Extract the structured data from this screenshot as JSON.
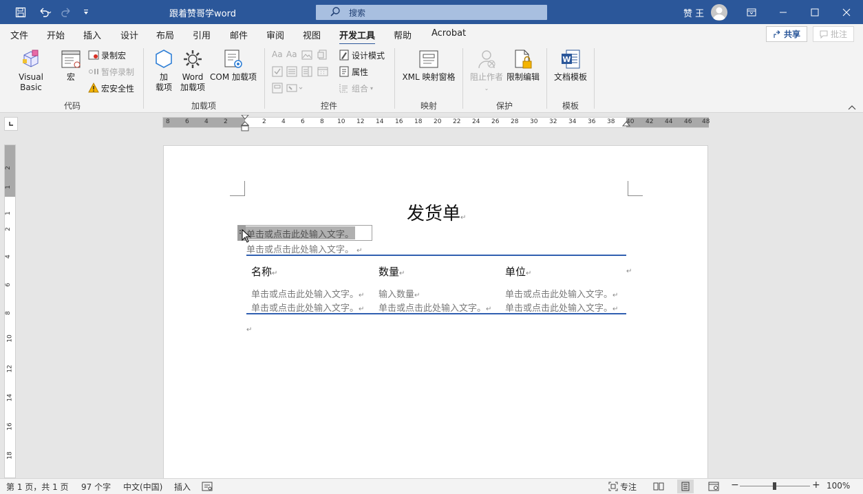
{
  "titlebar": {
    "title": "跟着赞哥学word",
    "search_placeholder": "搜索",
    "user_name": "赞 王",
    "bg_color": "#2b579a"
  },
  "tabs": [
    "文件",
    "开始",
    "插入",
    "设计",
    "布局",
    "引用",
    "邮件",
    "审阅",
    "视图",
    "开发工具",
    "帮助",
    "Acrobat"
  ],
  "active_tab": "开发工具",
  "tab_actions": {
    "share": "共享",
    "comments": "批注"
  },
  "ribbon": {
    "code": {
      "label": "代码",
      "visual_basic": "Visual Basic",
      "macros": "宏",
      "record_macro": "录制宏",
      "pause_recording": "暂停录制",
      "macro_security": "宏安全性"
    },
    "addins": {
      "label": "加载项",
      "addins_line1": "加",
      "addins_line2": "载项",
      "word_addins_line1": "Word",
      "word_addins_line2": "加载项",
      "com_addins": "COM 加载项"
    },
    "controls": {
      "label": "控件",
      "design_mode": "设计模式",
      "properties": "属性",
      "group": "组合"
    },
    "mapping": {
      "label": "映射",
      "xml_pane": "XML 映射窗格"
    },
    "protect": {
      "label": "保护",
      "block_authors": "阻止作者",
      "restrict_editing": "限制编辑"
    },
    "templates": {
      "label": "模板",
      "document_template": "文档模板"
    }
  },
  "ruler": {
    "numbers": [
      "8",
      "6",
      "4",
      "2",
      "2",
      "4",
      "6",
      "8",
      "10",
      "12",
      "14",
      "16",
      "18",
      "20",
      "22",
      "24",
      "26",
      "28",
      "30",
      "32",
      "34",
      "36",
      "38",
      "40",
      "42",
      "44",
      "46",
      "48"
    ],
    "vertical_numbers": [
      "2",
      "1",
      "1",
      "2",
      "4",
      "6",
      "8",
      "10",
      "12",
      "14",
      "16",
      "18"
    ]
  },
  "document": {
    "title": "发货单",
    "placeholder": "单击或点击此处输入文字。",
    "qty_placeholder": "输入数量",
    "col_name": "名称",
    "col_qty": "数量",
    "col_unit": "单位"
  },
  "statusbar": {
    "page": "第 1 页，共 1 页",
    "words": "97 个字",
    "language": "中文(中国)",
    "mode": "插入",
    "focus": "专注",
    "zoom": "100%",
    "zoom_level": 1.0
  }
}
